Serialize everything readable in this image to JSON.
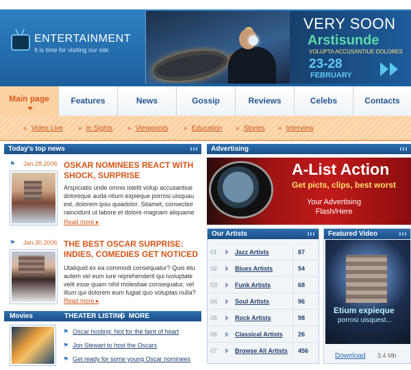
{
  "header": {
    "logo_title": "ENTERTAINMENT",
    "logo_tagline": "It is time for visiting our site",
    "banner": {
      "headline": "VERY SOON",
      "name": "Arstisunde",
      "subtitle": "VOLUPTA ACCUSANTIUE DOLORES",
      "dates": "23-28",
      "month": "FEBRUARY"
    }
  },
  "nav": {
    "items": [
      "Main page",
      "Features",
      "News",
      "Gossip",
      "Reviews",
      "Celebs",
      "Contacts"
    ],
    "active": "Main page"
  },
  "subnav": {
    "items": [
      "Video Live",
      "In Sights",
      "Viewpoints",
      "Education",
      "Stories",
      "Interview"
    ]
  },
  "top_news": {
    "title": "Today's top news",
    "items": [
      {
        "date": "Jan.28.2006",
        "headline_line1": "OSKAR NOMINEES REACT WITH",
        "headline_line2": "SHOCK, SURPRISE",
        "body": "Arspiciatis unde omnis istetit volup accusantiue doloreque auda ntium expieque porrosi uisquau est, dolorem ipsu quiadolor. Sitamet, consecteir raincidunt ut labore et dolore magnam aliquame",
        "more": "Read more"
      },
      {
        "date": "Jan.30.2006",
        "headline_line1": "THE BEST OSCAR SURPRISE:",
        "headline_line2": "INDIES, COMEDIES GET NOTICED",
        "body": "Utaliquid ex ea commodi consequatur? Quis etu autem vel eum iure reprehenderit qui ivoluptate velit esse quam nihil molestiae consequatur, vel illum qui dolorem eum fugiat quo voluptas nulla?",
        "more": "Read more"
      }
    ]
  },
  "movies": {
    "title": "Movies",
    "theater_listing": "THEATER LISTING",
    "separator": "|",
    "more": "MORE",
    "links": [
      "Oscar hosting: Not for the faint of heart",
      "Jon Stewart to host the Oscars",
      "Get ready for some young Oscar nominees"
    ]
  },
  "advertising": {
    "title": "Advertising",
    "ad_title": "A-List Action",
    "ad_sub": "Get picts, clips, best worst",
    "ad_line1": "Your Advertising",
    "ad_line2": "Flash/Here"
  },
  "artists": {
    "title": "Our Artists",
    "rows": [
      {
        "num": "01",
        "name": "Jazz Artists",
        "count": "87"
      },
      {
        "num": "02",
        "name": "Blues Artists",
        "count": "54"
      },
      {
        "num": "03",
        "name": "Funk Artists",
        "count": "68"
      },
      {
        "num": "04",
        "name": "Soul Artists",
        "count": "96"
      },
      {
        "num": "05",
        "name": "Rock Artists",
        "count": "98"
      },
      {
        "num": "06",
        "name": "Classical Artists",
        "count": "26"
      },
      {
        "num": "07",
        "name": "Browse All Artists",
        "count": "456"
      }
    ]
  },
  "featured_video": {
    "title": "Featured Video",
    "caption_title": "Etium expieque",
    "caption_sub": "porrosi uisquest...",
    "download": "Download",
    "size": "3.4 Mb"
  },
  "colors": {
    "header_blue": "#1c5f9d",
    "nav_active": "#fbd3a3",
    "accent_orange": "#d35418",
    "link_blue": "#1f3f6e"
  }
}
